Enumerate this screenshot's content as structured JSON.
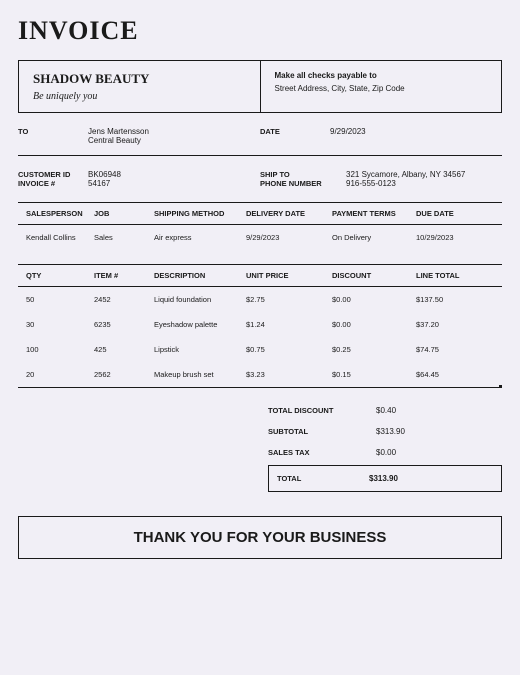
{
  "title": "INVOICE",
  "header": {
    "company": "SHADOW BEAUTY",
    "tagline": "Be uniquely you",
    "payable_label": "Make all checks payable to",
    "payable_address": "Street Address, City, State, Zip Code"
  },
  "to": {
    "label": "TO",
    "name": "Jens Martensson",
    "company": "Central Beauty"
  },
  "date": {
    "label": "DATE",
    "value": "9/29/2023"
  },
  "customer": {
    "id_label": "CUSTOMER ID",
    "id": "BK06948",
    "invoice_label": "INVOICE #",
    "invoice": "54167"
  },
  "ship": {
    "label1": "SHIP TO",
    "label2": "PHONE NUMBER",
    "address": "321 Sycamore, Albany, NY 34567",
    "phone": "916-555-0123"
  },
  "shipping_table": {
    "headers": [
      "SALESPERSON",
      "JOB",
      "SHIPPING METHOD",
      "DELIVERY DATE",
      "PAYMENT TERMS",
      "DUE DATE"
    ],
    "row": [
      "Kendall Collins",
      "Sales",
      "Air express",
      "9/29/2023",
      "On Delivery",
      "10/29/2023"
    ]
  },
  "items_table": {
    "headers": [
      "QTY",
      "ITEM #",
      "DESCRIPTION",
      "UNIT PRICE",
      "DISCOUNT",
      "LINE TOTAL"
    ],
    "rows": [
      [
        "50",
        "2452",
        "Liquid foundation",
        "$2.75",
        "$0.00",
        "$137.50"
      ],
      [
        "30",
        "6235",
        "Eyeshadow palette",
        "$1.24",
        "$0.00",
        "$37.20"
      ],
      [
        "100",
        "425",
        "Lipstick",
        "$0.75",
        "$0.25",
        "$74.75"
      ],
      [
        "20",
        "2562",
        "Makeup brush set",
        "$3.23",
        "$0.15",
        "$64.45"
      ]
    ]
  },
  "totals": {
    "discount_label": "TOTAL DISCOUNT",
    "discount": "$0.40",
    "subtotal_label": "SUBTOTAL",
    "subtotal": "$313.90",
    "tax_label": "SALES TAX",
    "tax": "$0.00",
    "total_label": "TOTAL",
    "total": "$313.90"
  },
  "thanks": "THANK YOU FOR YOUR BUSINESS"
}
